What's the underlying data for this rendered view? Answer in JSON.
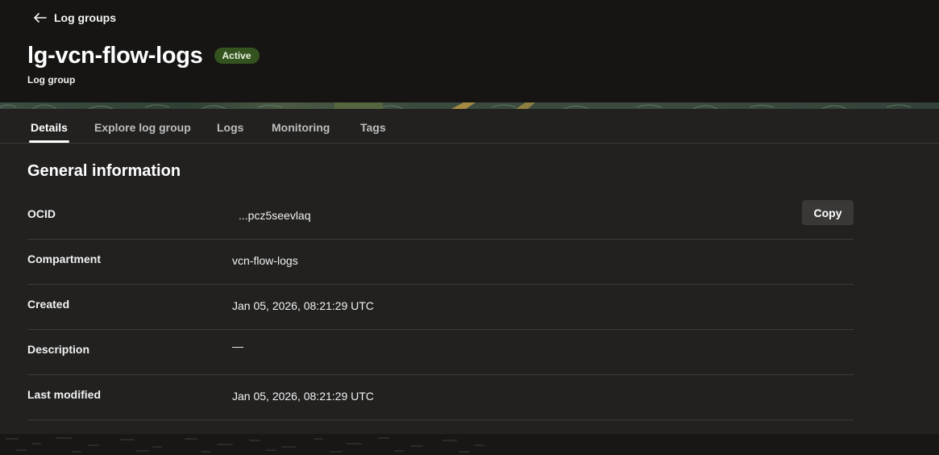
{
  "header": {
    "back_label": "Log groups",
    "title": "lg-vcn-flow-logs",
    "status": "Active",
    "subtitle": "Log group"
  },
  "tabs": [
    {
      "label": "Details",
      "active": true
    },
    {
      "label": "Explore log group",
      "active": false
    },
    {
      "label": "Logs",
      "active": false
    },
    {
      "label": "Monitoring",
      "active": false
    },
    {
      "label": "Tags",
      "active": false
    }
  ],
  "section": {
    "title": "General information"
  },
  "info": [
    {
      "label": "OCID",
      "value": "...pcz5seevlaq",
      "action": "Copy"
    },
    {
      "label": "Compartment",
      "value": "vcn-flow-logs"
    },
    {
      "label": "Created",
      "value": "Jan 05, 2026, 08:21:29 UTC"
    },
    {
      "label": "Description",
      "value": "—"
    },
    {
      "label": "Last modified",
      "value": "Jan 05, 2026, 08:21:29 UTC"
    }
  ],
  "icons": {
    "back": "arrow-left-icon"
  },
  "colors": {
    "background": "#1c1c1c",
    "header": "#161513",
    "panel": "#222120",
    "badge_bg": "#34531f",
    "button_bg": "#393837"
  }
}
